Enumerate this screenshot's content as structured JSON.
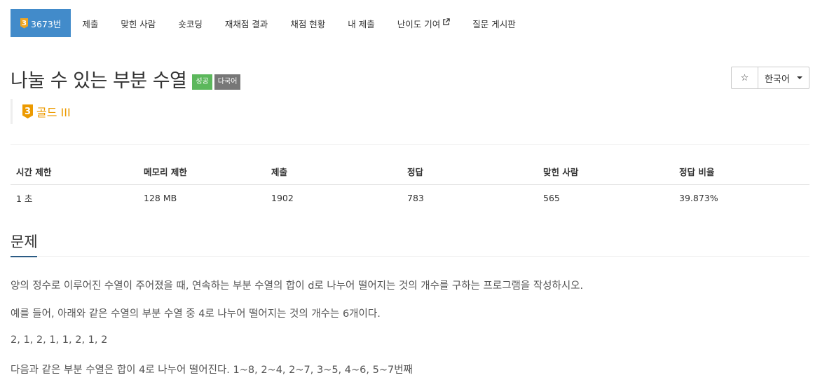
{
  "nav": {
    "problem_tier": "3",
    "problem_id": "3673번",
    "tabs": [
      "제출",
      "맞힌 사람",
      "숏코딩",
      "재채점 결과",
      "채점 현황",
      "내 제출",
      "난이도 기여",
      "질문 게시판"
    ]
  },
  "problem": {
    "title": "나눌 수 있는 부분 수열",
    "labels": [
      "성공",
      "다국어"
    ],
    "tier_number": "3",
    "tier_text": "골드 III",
    "language_button": "한국어",
    "star": "☆"
  },
  "info_table": {
    "headers": [
      "시간 제한",
      "메모리 제한",
      "제출",
      "정답",
      "맞힌 사람",
      "정답 비율"
    ],
    "values": [
      "1 초",
      "128 MB",
      "1902",
      "783",
      "565",
      "39.873%"
    ]
  },
  "section": {
    "title": "문제",
    "paragraphs": [
      "양의 정수로 이루어진 수열이 주어졌을 때, 연속하는 부분 수열의 합이 d로 나누어 떨어지는 것의 개수를 구하는 프로그램을 작성하시오.",
      "예를 들어, 아래와 같은 수열의 부분 수열 중 4로 나누어 떨어지는 것의 개수는 6개이다.",
      "2, 1, 2, 1, 1, 2, 1, 2",
      "다음과 같은 부분 수열은 합이 4로 나누어 떨어진다. 1~8, 2~4, 2~7, 3~5, 4~6, 5~7번째"
    ]
  },
  "colors": {
    "nav_active": "#428bca",
    "tier_gold": "#ec9a00",
    "label_success": "#5cb85c",
    "label_lang": "#777777",
    "section_underline": "#2b5b84"
  }
}
